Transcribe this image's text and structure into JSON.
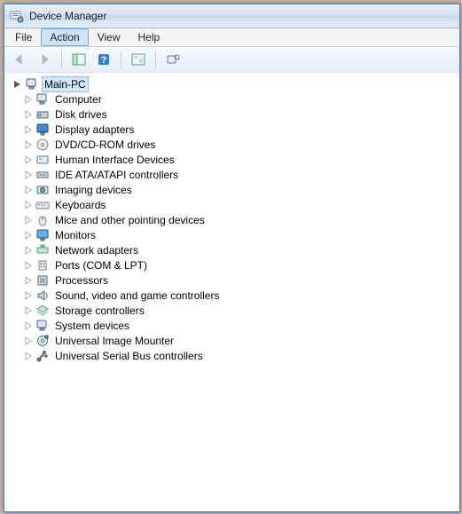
{
  "window": {
    "title": "Device Manager"
  },
  "menus": {
    "file": "File",
    "action": "Action",
    "view": "View",
    "help": "Help"
  },
  "root": "Main-PC",
  "categories": [
    "Computer",
    "Disk drives",
    "Display adapters",
    "DVD/CD-ROM drives",
    "Human Interface Devices",
    "IDE ATA/ATAPI controllers",
    "Imaging devices",
    "Keyboards",
    "Mice and other pointing devices",
    "Monitors",
    "Network adapters",
    "Ports (COM & LPT)",
    "Processors",
    "Sound, video and game controllers",
    "Storage controllers",
    "System devices",
    "Universal Image Mounter",
    "Universal Serial Bus controllers"
  ],
  "icons": [
    "computer",
    "disk",
    "display",
    "dvd",
    "hid",
    "ide",
    "imaging",
    "keyboard",
    "mouse",
    "monitor",
    "network",
    "port",
    "cpu",
    "sound",
    "storage",
    "system",
    "mounter",
    "usb"
  ]
}
